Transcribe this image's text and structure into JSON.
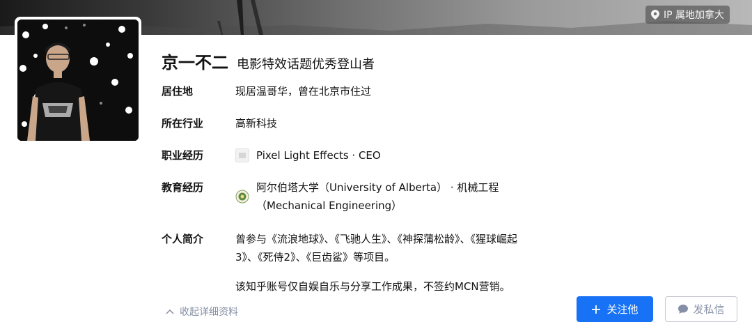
{
  "header": {
    "ip_location": "IP 属地加拿大",
    "ip_icon": "location-pin-icon"
  },
  "profile": {
    "name": "京一不二",
    "headline": "电影特效话题优秀登山者"
  },
  "details": {
    "residence": {
      "label": "居住地",
      "value": "现居温哥华，曾在北京市住过"
    },
    "industry": {
      "label": "所在行业",
      "value": "高新科技"
    },
    "career": {
      "label": "职业经历",
      "value": "Pixel Light Effects · CEO"
    },
    "education": {
      "label": "教育经历",
      "line1": "阿尔伯塔大学（University of Alberta） · 机械工程",
      "line2": "（Mechanical Engineering）"
    },
    "bio": {
      "label": "个人简介",
      "line1": "曾参与《流浪地球》、《飞驰人生》、《神探蒲松龄》、《猩球崛起",
      "line2": "3》、《死侍2》、《巨齿鲨》等项目。",
      "line3": "该知乎账号仅自娱自乐与分享工作成果，不签约MCN营销。"
    }
  },
  "actions": {
    "collapse_label": "收起详细资料",
    "follow_label": "关注他",
    "message_label": "发私信"
  },
  "colors": {
    "accent": "#1772f6",
    "muted": "#8590a6",
    "text": "#121212"
  }
}
